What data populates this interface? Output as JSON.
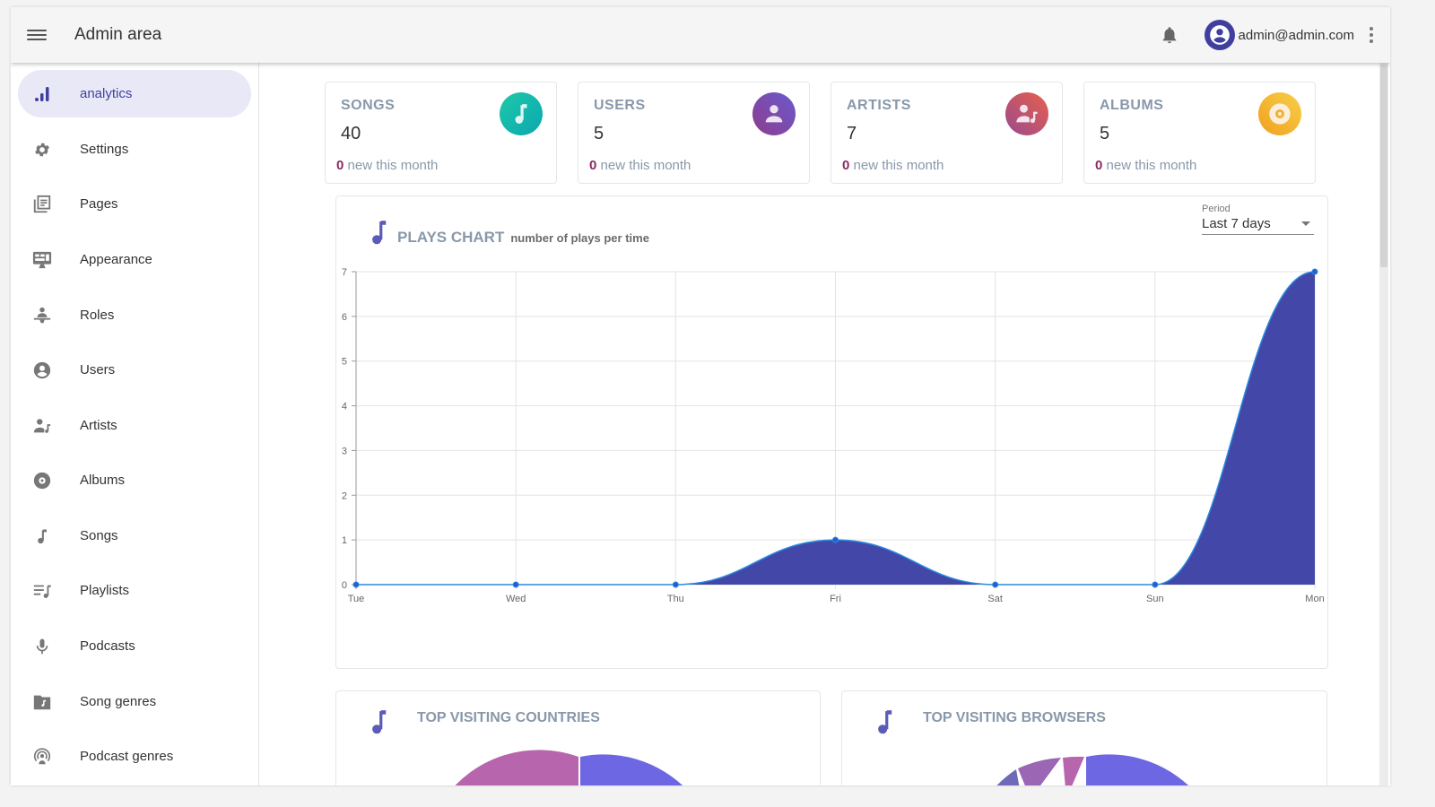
{
  "header": {
    "title": "Admin area",
    "user_email": "admin@admin.com",
    "icons": {
      "menu": "hamburger-icon",
      "notifications": "bell-icon",
      "avatar": "account-circle-icon",
      "more": "kebab-vertical-icon"
    }
  },
  "sidebar": {
    "items": [
      {
        "label": "analytics",
        "icon": "bar-chart-icon",
        "active": true
      },
      {
        "label": "Settings",
        "icon": "gear-icon"
      },
      {
        "label": "Pages",
        "icon": "pages-icon"
      },
      {
        "label": "Appearance",
        "icon": "monitor-icon"
      },
      {
        "label": "Roles",
        "icon": "roles-icon"
      },
      {
        "label": "Users",
        "icon": "account-circle-icon"
      },
      {
        "label": "Artists",
        "icon": "artist-icon"
      },
      {
        "label": "Albums",
        "icon": "album-icon"
      },
      {
        "label": "Songs",
        "icon": "music-note-icon"
      },
      {
        "label": "Playlists",
        "icon": "playlist-icon"
      },
      {
        "label": "Podcasts",
        "icon": "microphone-icon"
      },
      {
        "label": "Song genres",
        "icon": "music-folder-icon"
      },
      {
        "label": "Podcast genres",
        "icon": "podcast-icon"
      }
    ]
  },
  "stats": [
    {
      "title": "SONGS",
      "value": "40",
      "new_count": "0",
      "new_label": "new this month",
      "icon": "music-note-icon",
      "color_from": "#1fc8a8",
      "color_to": "#0aa8b0"
    },
    {
      "title": "USERS",
      "value": "5",
      "new_count": "0",
      "new_label": "new this month",
      "icon": "account-icon",
      "color_from": "#6a5acd",
      "color_to": "#8e3d8e"
    },
    {
      "title": "ARTISTS",
      "value": "7",
      "new_count": "0",
      "new_label": "new this month",
      "icon": "artist-icon",
      "color_from": "#e8604c",
      "color_to": "#9a4a8e"
    },
    {
      "title": "ALBUMS",
      "value": "5",
      "new_count": "0",
      "new_label": "new this month",
      "icon": "album-icon",
      "color_from": "#f7d048",
      "color_to": "#f0a020"
    }
  ],
  "plays_chart": {
    "title": "PLAYS CHART",
    "subtitle": "number of plays per time",
    "period_label": "Period",
    "period_value": "Last 7 days"
  },
  "chart_data": {
    "type": "area",
    "title": "PLAYS CHART",
    "subtitle": "number of plays per time",
    "categories": [
      "Tue",
      "Wed",
      "Thu",
      "Fri",
      "Sat",
      "Sun",
      "Mon"
    ],
    "series": [
      {
        "name": "plays",
        "values": [
          0,
          0,
          0,
          1,
          0,
          0,
          7
        ],
        "fill": "#4347a8",
        "line": "#2a8ae0"
      }
    ],
    "yticks": [
      "0",
      "1",
      "2",
      "3",
      "4",
      "5",
      "6",
      "7"
    ],
    "ylim": [
      0,
      7
    ],
    "xlabel": "",
    "ylabel": "",
    "grid": true
  },
  "bottom_cards": [
    {
      "title": "TOP VISITING COUNTRIES",
      "icon": "music-note-icon"
    },
    {
      "title": "TOP VISITING BROWSERS",
      "icon": "music-note-icon"
    }
  ]
}
